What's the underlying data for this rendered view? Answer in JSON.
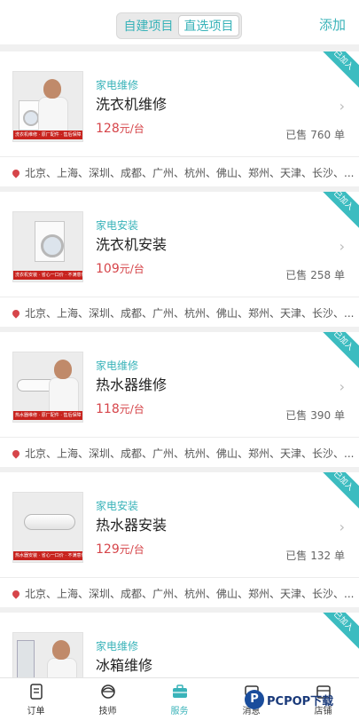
{
  "header": {
    "segments": [
      {
        "label": "自建项目",
        "active": false
      },
      {
        "label": "直选项目",
        "active": true
      }
    ],
    "add_label": "添加"
  },
  "colors": {
    "accent": "#39b3b9",
    "price": "#d6454a",
    "ribbon": "#3cbcc0"
  },
  "services": [
    {
      "category": "家电维修",
      "title": "洗衣机维修",
      "price": "128",
      "unit": "元/台",
      "sold_label": "已售",
      "sold": "760 单",
      "badge": "已加入",
      "thumb_caption": "洗衣机维修  ·  原厂配件 · 售后保障",
      "cities": "北京、上海、深圳、成都、广州、杭州、佛山、郑州、天津、长沙、..."
    },
    {
      "category": "家电安装",
      "title": "洗衣机安装",
      "price": "109",
      "unit": "元/台",
      "sold_label": "已售",
      "sold": "258 单",
      "badge": "已加入",
      "thumb_caption": "洗衣机安装  ·  省心一口价 · 不满意包退",
      "cities": "北京、上海、深圳、成都、广州、杭州、佛山、郑州、天津、长沙、..."
    },
    {
      "category": "家电维修",
      "title": "热水器维修",
      "price": "118",
      "unit": "元/台",
      "sold_label": "已售",
      "sold": "390 单",
      "badge": "已加入",
      "thumb_caption": "热水器维修  ·  原厂配件 · 售后保障",
      "cities": "北京、上海、深圳、成都、广州、杭州、佛山、郑州、天津、长沙、..."
    },
    {
      "category": "家电安装",
      "title": "热水器安装",
      "price": "129",
      "unit": "元/台",
      "sold_label": "已售",
      "sold": "132 单",
      "badge": "已加入",
      "thumb_caption": "热水器安装  ·  省心一口价 · 不满意包退",
      "cities": "北京、上海、深圳、成都、广州、杭州、佛山、郑州、天津、长沙、..."
    },
    {
      "category": "家电维修",
      "title": "冰箱维修",
      "badge": "已加入"
    }
  ],
  "tabbar": [
    {
      "label": "订单",
      "icon": "order-icon",
      "active": false
    },
    {
      "label": "技师",
      "icon": "technician-icon",
      "active": false
    },
    {
      "label": "服务",
      "icon": "toolbox-icon",
      "active": true
    },
    {
      "label": "消息",
      "icon": "message-icon",
      "active": false
    },
    {
      "label": "店铺",
      "icon": "store-icon",
      "active": false
    }
  ],
  "watermark": {
    "logo": "P",
    "text": "PCPOP下载"
  }
}
